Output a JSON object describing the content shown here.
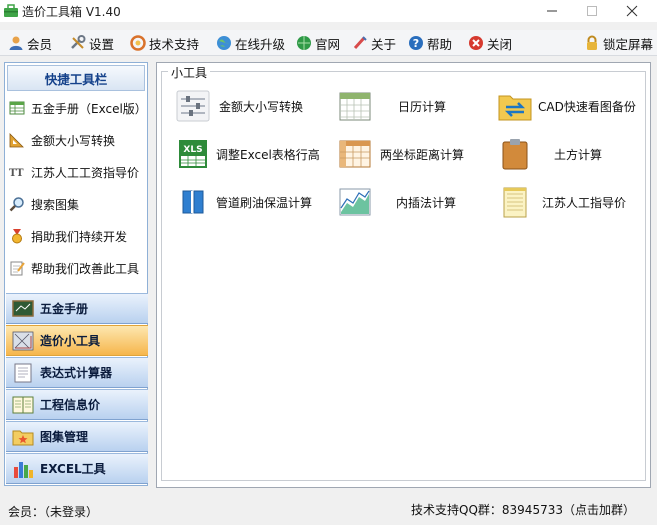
{
  "window": {
    "title": "造价工具箱 V1.40"
  },
  "toolbar": {
    "items": [
      {
        "label": "会员",
        "icon": "user-icon"
      },
      {
        "label": "设置",
        "icon": "wrench-icon"
      },
      {
        "label": "技术支持",
        "icon": "support-icon"
      },
      {
        "label": "在线升级",
        "icon": "globe-icon"
      },
      {
        "label": "官网",
        "icon": "website-icon"
      },
      {
        "label": "关于",
        "icon": "about-icon"
      },
      {
        "label": "帮助",
        "icon": "help-icon"
      },
      {
        "label": "关闭",
        "icon": "close-icon"
      }
    ],
    "lock_label": "锁定屏幕"
  },
  "sidebar": {
    "header": "快捷工具栏",
    "quick_items": [
      {
        "label": "五金手册（Excel版）",
        "icon": "table-icon"
      },
      {
        "label": "金额大小写转换",
        "icon": "triangle-ruler-icon"
      },
      {
        "label": "江苏人工工资指导价",
        "icon": "text-icon"
      },
      {
        "label": "搜索图集",
        "icon": "magnifier-icon"
      },
      {
        "label": "捐助我们持续开发",
        "icon": "medal-icon"
      },
      {
        "label": "帮助我们改善此工具",
        "icon": "notepad-icon"
      }
    ],
    "nav": [
      {
        "label": "五金手册",
        "icon": "blackboard-icon"
      },
      {
        "label": "造价小工具",
        "icon": "drafting-icon"
      },
      {
        "label": "表达式计算器",
        "icon": "document-icon"
      },
      {
        "label": "工程信息价",
        "icon": "ledger-icon"
      },
      {
        "label": "图集管理",
        "icon": "star-folder-icon"
      },
      {
        "label": "EXCEL工具",
        "icon": "bar-chart-icon"
      }
    ]
  },
  "main": {
    "group_title": "小工具",
    "tools": [
      {
        "label": "金额大小写转换",
        "icon": "sliders-icon"
      },
      {
        "label": "日历计算",
        "icon": "calendar-icon"
      },
      {
        "label": "CAD快速看图备份",
        "icon": "sync-folder-icon"
      },
      {
        "label": "调整Excel表格行高",
        "icon": "xls-icon"
      },
      {
        "label": "两坐标距离计算",
        "icon": "grid-table-icon"
      },
      {
        "label": "土方计算",
        "icon": "clipboard-icon"
      },
      {
        "label": "管道刷油保温计算",
        "icon": "book-icon"
      },
      {
        "label": "内插法计算",
        "icon": "area-chart-icon"
      },
      {
        "label": "江苏人工指导价",
        "icon": "lined-paper-icon"
      }
    ]
  },
  "status": {
    "user": "会员：（未登录）",
    "support": "技术支持QQ群：83945733（点击加群）"
  }
}
